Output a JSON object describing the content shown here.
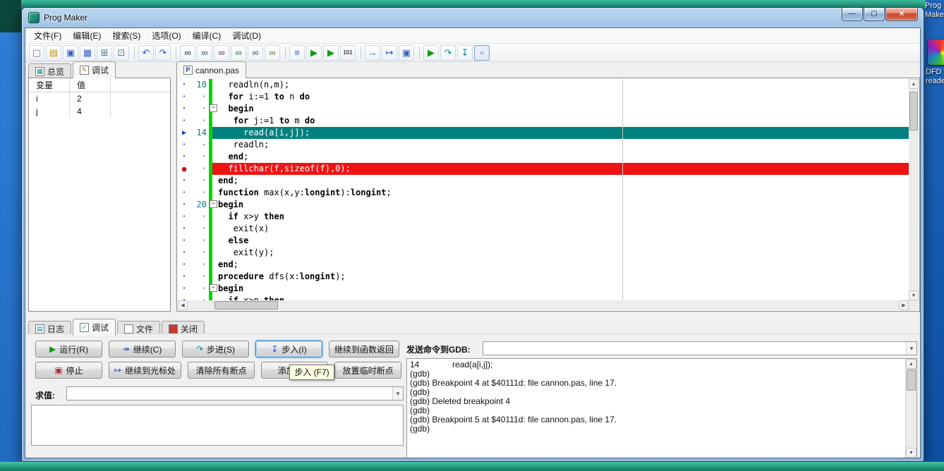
{
  "desktop": {
    "icon_prog_label": "Prog Maker",
    "icon_dfd_label": "DFD reader"
  },
  "window": {
    "title": "Prog Maker",
    "caption_buttons": [
      {
        "name": "minimize",
        "glyph": "—"
      },
      {
        "name": "maximize",
        "glyph": "▢"
      },
      {
        "name": "close",
        "glyph": "×"
      }
    ]
  },
  "icons": {
    "scroll_up": "▲",
    "scroll_down": "▼",
    "scroll_left": "◀",
    "scroll_right": "▶",
    "dropdown": "▾"
  },
  "menu": {
    "items": [
      "文件(F)",
      "编辑(E)",
      "搜索(S)",
      "选项(O)",
      "编译(C)",
      "调试(D)"
    ]
  },
  "toolbar": {
    "buttons": [
      {
        "name": "new-file",
        "glyph": "▢",
        "color": "#707070"
      },
      {
        "name": "open-file",
        "glyph": "▤",
        "color": "#c09020"
      },
      {
        "name": "save-file",
        "glyph": "▣",
        "color": "#3a5fc0"
      },
      {
        "name": "save-all",
        "glyph": "▦",
        "color": "#3a5fc0"
      },
      {
        "name": "project-window",
        "glyph": "⊞",
        "color": "#4a7a8a"
      },
      {
        "name": "window-list",
        "glyph": "⊡",
        "color": "#4a7a8a"
      },
      {
        "sep": true
      },
      {
        "name": "undo",
        "glyph": "↶",
        "color": "#2255cc"
      },
      {
        "name": "redo",
        "glyph": "↷",
        "color": "#2255cc"
      },
      {
        "sep": true
      },
      {
        "name": "find",
        "glyph": "∞",
        "color": "#303030"
      },
      {
        "name": "find-next",
        "glyph": "∞",
        "color": "#304870"
      },
      {
        "name": "find-previous",
        "glyph": "∞",
        "color": "#703048"
      },
      {
        "name": "replace",
        "glyph": "∞",
        "color": "#307048"
      },
      {
        "name": "find-in-files",
        "glyph": "∞",
        "color": "#484870"
      },
      {
        "name": "search-again",
        "glyph": "∞",
        "color": "#707030"
      },
      {
        "sep": true
      },
      {
        "name": "compile",
        "glyph": "≡",
        "color": "#3060c0"
      },
      {
        "name": "run",
        "glyph": "▶",
        "color": "#0d9d0d"
      },
      {
        "name": "compile-and-run",
        "glyph": "▶",
        "color": "#0d9d0d"
      },
      {
        "name": "build-all",
        "glyph": "101",
        "color": "#404040"
      },
      {
        "sep": true
      },
      {
        "name": "step-to-cursor",
        "glyph": "→",
        "color": "#2255cc"
      },
      {
        "name": "step-out",
        "glyph": "↦",
        "color": "#2255cc"
      },
      {
        "name": "save-session",
        "glyph": "▣",
        "color": "#3a5fc0"
      },
      {
        "sep": true
      },
      {
        "name": "debug-run",
        "glyph": "▶",
        "color": "#0d9d0d"
      },
      {
        "name": "step-over",
        "glyph": "↷",
        "color": "#0a8a8a"
      },
      {
        "name": "trace-into",
        "glyph": "↧",
        "color": "#0a8a8a"
      },
      {
        "name": "breakpoint-list",
        "glyph": "▫",
        "color": "#555555",
        "framed": true
      }
    ]
  },
  "left_panel": {
    "tabs": [
      {
        "name": "overview",
        "label": "总览",
        "icon": "▦",
        "icon_color": "#0a8a8a",
        "active": false
      },
      {
        "name": "debug",
        "label": "调试",
        "icon": "✎",
        "icon_color": "#b06000",
        "active": true
      }
    ],
    "watch_headers": [
      "变量",
      "值"
    ],
    "watch_rows": [
      {
        "name": "i",
        "value": "2"
      },
      {
        "name": "j",
        "value": "4"
      }
    ]
  },
  "editor": {
    "tab_label": "cannon.pas",
    "tab_icon": "P",
    "fold_glyph": "−",
    "marker_glyphs": {
      "dot": "•",
      "current": "▶",
      "breakpoint": "●"
    },
    "keywords": [
      "begin",
      "end",
      "for",
      "to",
      "do",
      "if",
      "then",
      "else",
      "function",
      "procedure",
      "longint"
    ],
    "lines": [
      {
        "marker": "dot",
        "num": "10",
        "code": "  readln(n,m);"
      },
      {
        "marker": "dot",
        "num": "·",
        "code": "  for i:=1 to n do"
      },
      {
        "marker": "dot",
        "num": "·",
        "fold": true,
        "code": "  begin"
      },
      {
        "marker": "dot",
        "num": "·",
        "code": "   for j:=1 to m do"
      },
      {
        "marker": "current",
        "num": "14",
        "code": "     read(a[i,j]);",
        "hl": "current"
      },
      {
        "marker": "dot",
        "num": "-",
        "code": "   readln;"
      },
      {
        "marker": "dot",
        "num": "·",
        "code": "  end;"
      },
      {
        "marker": "breakpoint",
        "num": "·",
        "code": "  fillchar(f,sizeof(f),0);",
        "hl": "breakpoint"
      },
      {
        "marker": "dot",
        "num": "·",
        "code": "end;"
      },
      {
        "marker": "dot",
        "num": "·",
        "code": "function max(x,y:longint):longint;"
      },
      {
        "marker": "dot",
        "num": "20",
        "fold": true,
        "code": "begin"
      },
      {
        "marker": "dot",
        "num": "·",
        "code": "  if x>y then"
      },
      {
        "marker": "dot",
        "num": "·",
        "code": "   exit(x)"
      },
      {
        "marker": "dot",
        "num": "·",
        "code": "  else"
      },
      {
        "marker": "dot",
        "num": "·",
        "code": "   exit(y);"
      },
      {
        "marker": "dot",
        "num": "·",
        "code": "end;"
      },
      {
        "marker": "dot",
        "num": "·",
        "code": "procedure dfs(x:longint);"
      },
      {
        "marker": "dot",
        "num": "·",
        "fold": true,
        "code": "begin"
      },
      {
        "marker": "dot",
        "num": "·",
        "code": "  if x>n then"
      }
    ]
  },
  "bottom": {
    "tabs": [
      {
        "name": "log",
        "label": "日志",
        "icon": "▤",
        "icon_color": "#0a8a8a",
        "active": false
      },
      {
        "name": "debug",
        "label": "调试",
        "icon": "✓",
        "icon_color": "#0a8a8a",
        "active": true
      },
      {
        "name": "files",
        "label": "文件",
        "icon": "",
        "icon_color": "#888888",
        "active": false
      },
      {
        "name": "close",
        "label": "关闭",
        "icon": "",
        "icon_color": "#ffffff",
        "icon_bg": "#c43a2e",
        "active": false
      }
    ],
    "debug_buttons_row1": [
      {
        "name": "run",
        "label": "运行(R)",
        "glyph": "▶",
        "glyph_color": "#0d9d0d"
      },
      {
        "name": "continue",
        "label": "继续(C)",
        "glyph": "↠",
        "glyph_color": "#2255cc"
      },
      {
        "name": "step-over",
        "label": "步进(S)",
        "glyph": "↷",
        "glyph_color": "#0a8a8a"
      },
      {
        "name": "step-into",
        "label": "步入(I)",
        "glyph": "↧",
        "glyph_color": "#2255cc",
        "focused": true
      },
      {
        "name": "run-to-return",
        "label": "继续到函数返回"
      }
    ],
    "debug_buttons_row2": [
      {
        "name": "stop",
        "label": "停止",
        "glyph": "▣",
        "glyph_color": "#b03030"
      },
      {
        "name": "run-to-cursor",
        "label": "继续到光标处",
        "glyph": "↦",
        "glyph_color": "#2255cc"
      },
      {
        "name": "clear-breakpoints",
        "label": "清除所有断点"
      },
      {
        "name": "add-watch",
        "label": "添加观察"
      },
      {
        "name": "temp-breakpoint",
        "label": "放置临时断点"
      }
    ],
    "tooltip": "步入 (F7)",
    "eval_label": "求值:",
    "gdb_label": "发送命令到GDB:",
    "gdb_output": [
      "14              read(a[i,j]);",
      "(gdb)",
      "(gdb) Breakpoint 4 at $40111d: file cannon.pas, line 17.",
      "(gdb)",
      "(gdb) Deleted breakpoint 4",
      "(gdb)",
      "(gdb) Breakpoint 5 at $40111d: file cannon.pas, line 17.",
      "(gdb)"
    ]
  }
}
